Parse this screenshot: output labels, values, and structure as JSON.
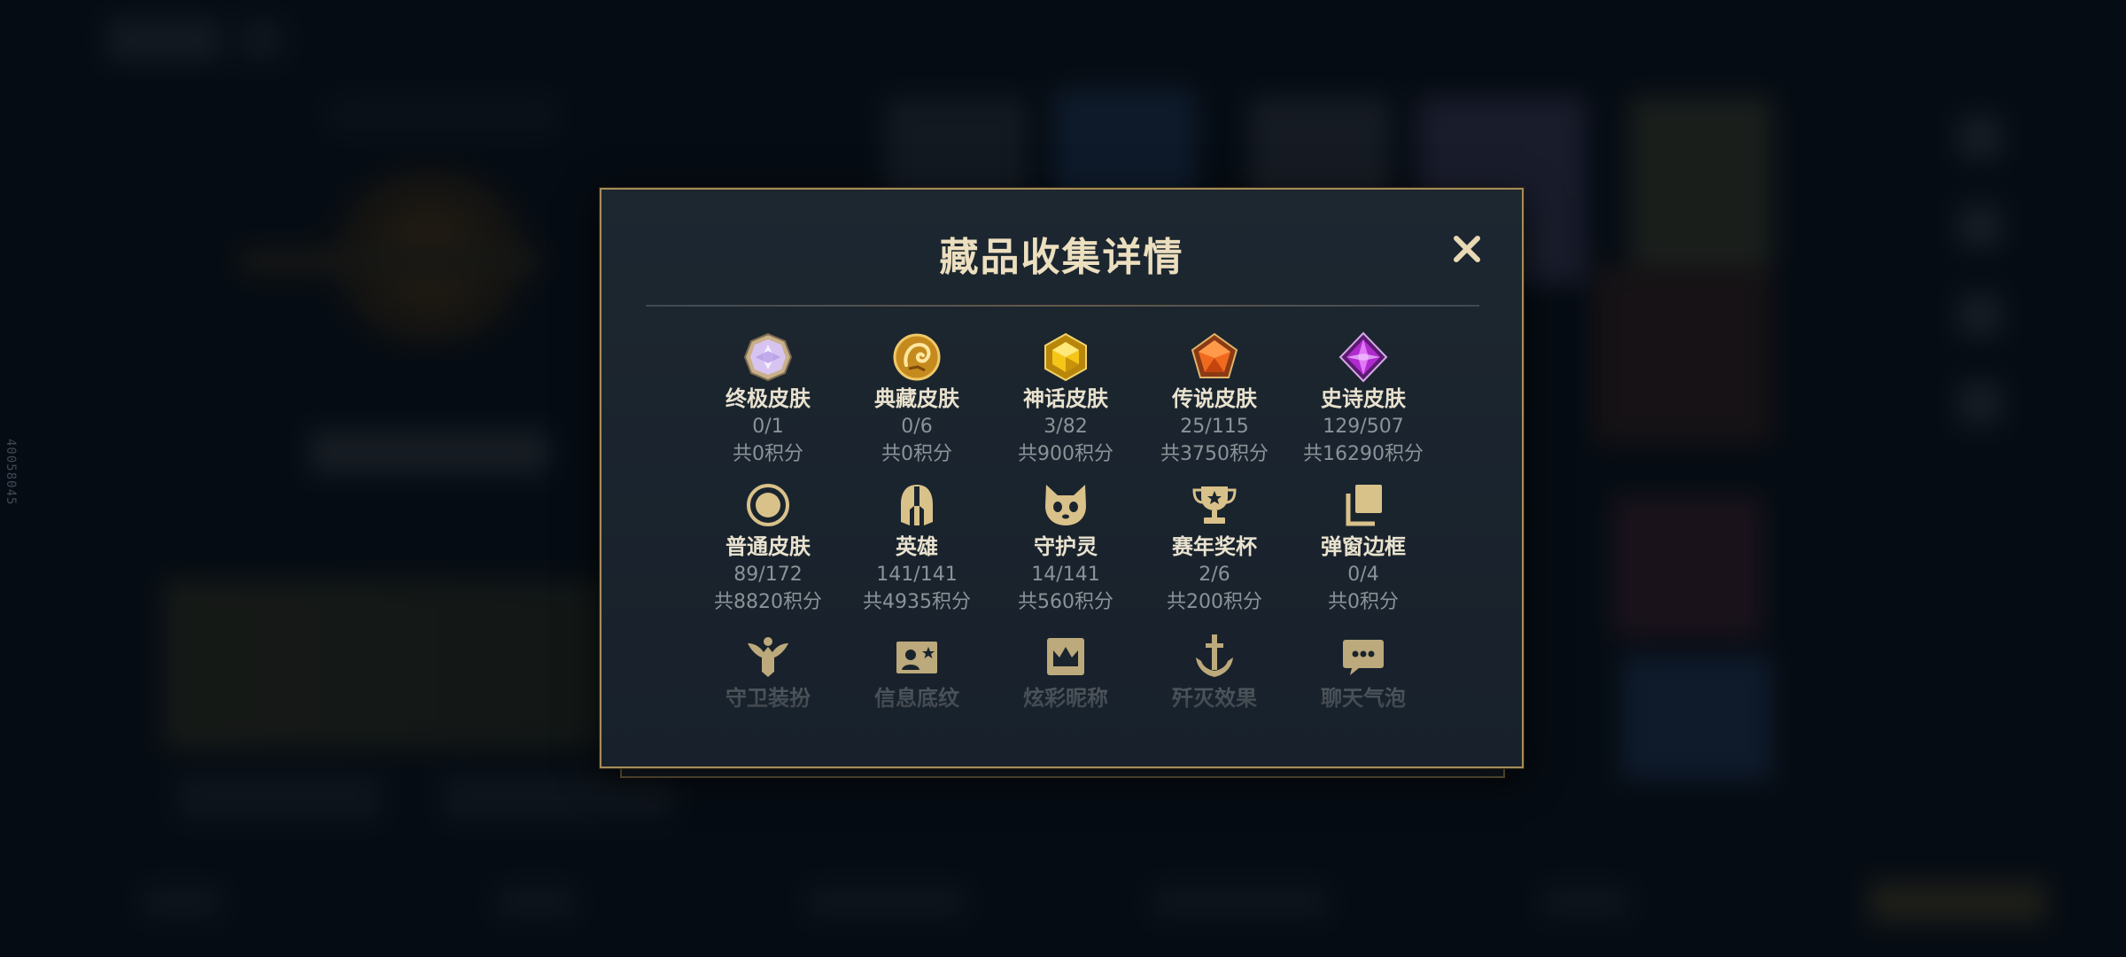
{
  "background": {
    "side_id": "40058045"
  },
  "dialog": {
    "title": "藏品收集详情",
    "close_label": "×",
    "items": [
      {
        "name": "终极皮肤",
        "count": "0/1",
        "points": "共0积分",
        "icon": "ultimate-gem-icon"
      },
      {
        "name": "典藏皮肤",
        "count": "0/6",
        "points": "共0积分",
        "icon": "prestige-dragon-icon"
      },
      {
        "name": "神话皮肤",
        "count": "3/82",
        "points": "共900积分",
        "icon": "mythic-gem-icon"
      },
      {
        "name": "传说皮肤",
        "count": "25/115",
        "points": "共3750积分",
        "icon": "legendary-gem-icon"
      },
      {
        "name": "史诗皮肤",
        "count": "129/507",
        "points": "共16290积分",
        "icon": "epic-gem-icon"
      },
      {
        "name": "普通皮肤",
        "count": "89/172",
        "points": "共8820积分",
        "icon": "normal-skin-icon"
      },
      {
        "name": "英雄",
        "count": "141/141",
        "points": "共4935积分",
        "icon": "helmet-icon"
      },
      {
        "name": "守护灵",
        "count": "14/141",
        "points": "共560积分",
        "icon": "guardian-spirit-icon"
      },
      {
        "name": "赛年奖杯",
        "count": "2/6",
        "points": "共200积分",
        "icon": "trophy-icon"
      },
      {
        "name": "弹窗边框",
        "count": "0/4",
        "points": "共0积分",
        "icon": "stacked-frames-icon"
      },
      {
        "name": "守卫装扮",
        "icon": "ward-skin-icon"
      },
      {
        "name": "信息底纹",
        "icon": "profile-banner-icon"
      },
      {
        "name": "炫彩昵称",
        "icon": "crown-nameplate-icon"
      },
      {
        "name": "歼灭效果",
        "icon": "sword-emblem-icon"
      },
      {
        "name": "聊天气泡",
        "icon": "chat-bubble-icon"
      }
    ]
  },
  "colors": {
    "accent_gold": "#a68c57",
    "title_text": "#ecdfbf",
    "subtext": "#8b9298",
    "dialog_bg": "#1b252e",
    "icon_gold": "#d9c18a"
  }
}
